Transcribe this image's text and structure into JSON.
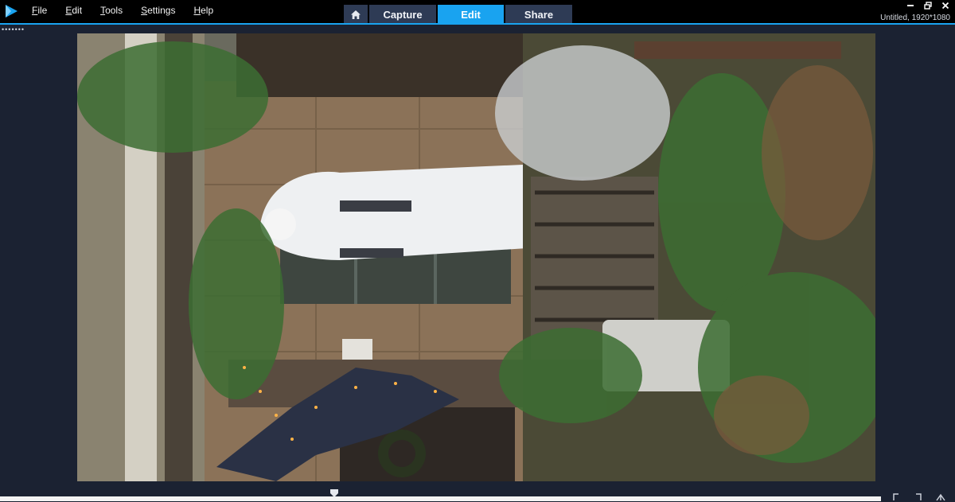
{
  "menu": {
    "items": [
      {
        "accel": "F",
        "rest": "ile"
      },
      {
        "accel": "E",
        "rest": "dit"
      },
      {
        "accel": "T",
        "rest": "ools"
      },
      {
        "accel": "S",
        "rest": "ettings"
      },
      {
        "accel": "H",
        "rest": "elp"
      }
    ]
  },
  "nav": {
    "home_icon": "home-icon",
    "capture_label": "Capture",
    "edit_label": "Edit",
    "share_label": "Share",
    "active": "Edit"
  },
  "project": {
    "info": "Untitled, 1920*1080"
  },
  "colors": {
    "accent": "#19a3f0",
    "titlebar": "#000000",
    "workspace": "#1b2232",
    "nav_button": "#2e3b55"
  },
  "timeline": {
    "icons": [
      "mark-in-icon",
      "mark-out-icon",
      "split-icon",
      "fullscreen-icon"
    ]
  }
}
